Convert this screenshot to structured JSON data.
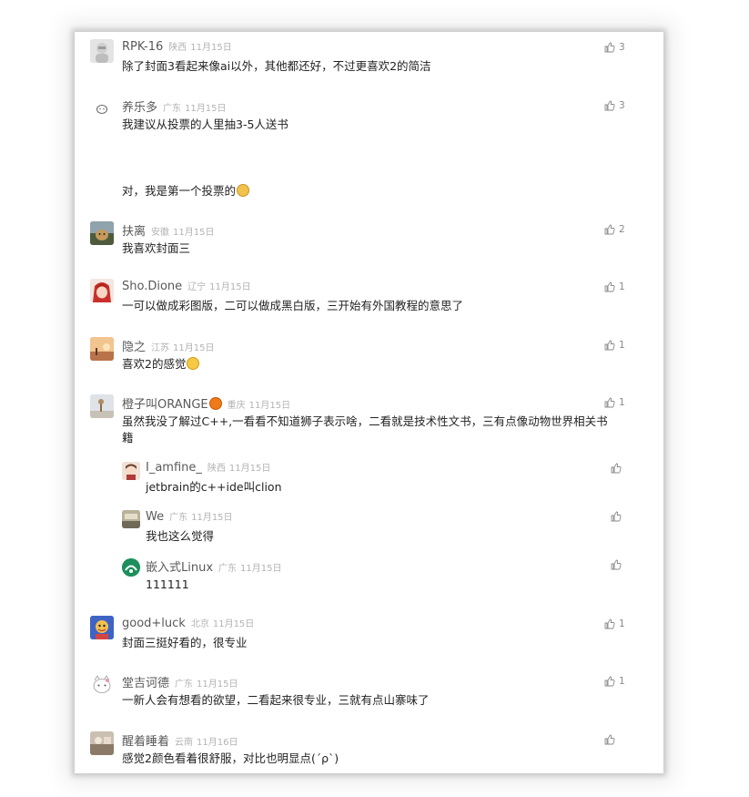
{
  "comments": [
    {
      "name": "RPK-16",
      "loc": "陕西",
      "date": "11月15日",
      "text": "除了封面3看起来像ai以外，其他都还好，不过更喜欢2的简洁",
      "likes": "3",
      "avatar": "gray-character"
    },
    {
      "name": "养乐多",
      "loc": "广东",
      "date": "11月15日",
      "text": "我建议从投票的人里抽3-5人送书",
      "text2": "对，我是第一个投票的",
      "likes": "3",
      "avatar": "white-blob"
    },
    {
      "name": "扶离",
      "loc": "安徽",
      "date": "11月15日",
      "text": "我喜欢封面三",
      "likes": "2",
      "avatar": "brown-animal"
    },
    {
      "name": "Sho.Dione",
      "loc": "辽宁",
      "date": "11月15日",
      "text": "一可以做成彩图版，二可以做成黑白版，三开始有外国教程的意思了",
      "likes": "1",
      "avatar": "red-hair-character"
    },
    {
      "name": "隐之",
      "loc": "江苏",
      "date": "11月15日",
      "text": "喜欢2的感觉",
      "likes": "1",
      "avatar": "sunset-landscape"
    },
    {
      "name": "橙子叫ORANGE",
      "loc": "重庆",
      "date": "11月15日",
      "text": "虽然我没了解过C++,一看看不知道狮子表示啥，二看就是技术性文书，三有点像动物世界相关书",
      "text_cont": "籍",
      "likes": "1",
      "avatar": "misty-scene"
    },
    {
      "name": "good+luck",
      "loc": "北京",
      "date": "11月15日",
      "text": "封面三挺好看的，很专业",
      "likes": "1",
      "avatar": "cartoon-mascot"
    },
    {
      "name": "堂吉诃德",
      "loc": "广东",
      "date": "11月15日",
      "text": "一新人会有想看的欲望，二看起来很专业，三就有点山寨味了",
      "likes": "1",
      "avatar": "white-cat"
    },
    {
      "name": "醒着睡着",
      "loc": "云南",
      "date": "11月16日",
      "text": "感觉2颜色看着很舒服，对比也明显点(´ρ`)",
      "likes": "",
      "avatar": "photo"
    }
  ],
  "replies": [
    {
      "name": "I_amfine_",
      "loc": "陕西",
      "date": "11月15日",
      "text": "jetbrain的c++ide叫clion",
      "likes": ""
    },
    {
      "name": "We",
      "loc": "广东",
      "date": "11月15日",
      "text": "我也这么觉得",
      "likes": ""
    },
    {
      "name": "嵌入式Linux",
      "loc": "广东",
      "date": "11月15日",
      "text": "111111",
      "likes": ""
    }
  ],
  "icons": {
    "like": "thumbs-up-icon",
    "emoji_cat": "cat-face-emoji",
    "emoji_grin": "grinning-face-emoji",
    "orange": "orange-fruit-emoji"
  }
}
